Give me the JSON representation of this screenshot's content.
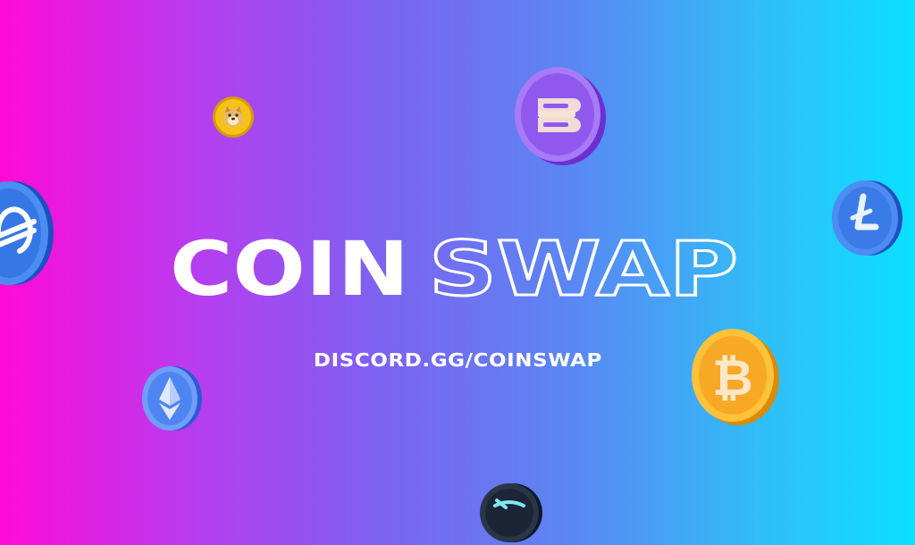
{
  "brand": {
    "title_solid": "COIN",
    "title_outline": "SWAP",
    "invite": "DISCORD.GG/COINSWAP"
  },
  "coins": [
    {
      "icon": "dogecoin-icon",
      "color": "#f2b705"
    },
    {
      "icon": "dash-coin-icon",
      "color": "#9b5cf0"
    },
    {
      "icon": "stellar-coin-icon",
      "color": "#3b82f6"
    },
    {
      "icon": "litecoin-icon",
      "color": "#3b82f6"
    },
    {
      "icon": "bitcoin-icon",
      "color": "#f5a623"
    },
    {
      "icon": "ethereum-icon",
      "color": "#4f7df5"
    },
    {
      "icon": "swap-coin-icon",
      "color": "#1e2a3a"
    }
  ],
  "colors": {
    "gradient_left": "#ff0ad6",
    "gradient_right": "#0be0ff",
    "text": "#ffffff"
  }
}
